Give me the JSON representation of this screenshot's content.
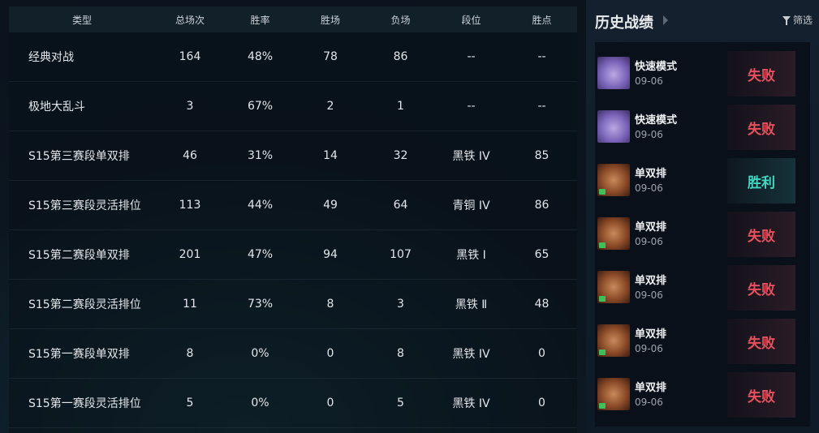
{
  "table": {
    "headers": [
      "类型",
      "总场次",
      "胜率",
      "胜场",
      "负场",
      "段位",
      "胜点"
    ],
    "rows": [
      [
        "经典对战",
        "164",
        "48%",
        "78",
        "86",
        "--",
        "--"
      ],
      [
        "极地大乱斗",
        "3",
        "67%",
        "2",
        "1",
        "--",
        "--"
      ],
      [
        "S15第三赛段单双排",
        "46",
        "31%",
        "14",
        "32",
        "黑铁 IV",
        "85"
      ],
      [
        "S15第三赛段灵活排位",
        "113",
        "44%",
        "49",
        "64",
        "青铜 IV",
        "86"
      ],
      [
        "S15第二赛段单双排",
        "201",
        "47%",
        "94",
        "107",
        "黑铁 Ⅰ",
        "65"
      ],
      [
        "S15第二赛段灵活排位",
        "11",
        "73%",
        "8",
        "3",
        "黑铁 Ⅱ",
        "48"
      ],
      [
        "S15第一赛段单双排",
        "8",
        "0%",
        "0",
        "8",
        "黑铁 IV",
        "0"
      ],
      [
        "S15第一赛段灵活排位",
        "5",
        "0%",
        "0",
        "5",
        "黑铁 IV",
        "0"
      ]
    ]
  },
  "history": {
    "title": "历史战绩",
    "filter_label": "筛选",
    "matches": [
      {
        "mode": "快速模式",
        "date": "09-06",
        "result": "失败",
        "win": false,
        "avatar": "poro"
      },
      {
        "mode": "快速模式",
        "date": "09-06",
        "result": "失败",
        "win": false,
        "avatar": "poro"
      },
      {
        "mode": "单双排",
        "date": "09-06",
        "result": "胜利",
        "win": true,
        "avatar": "girl"
      },
      {
        "mode": "单双排",
        "date": "09-06",
        "result": "失败",
        "win": false,
        "avatar": "girl"
      },
      {
        "mode": "单双排",
        "date": "09-06",
        "result": "失败",
        "win": false,
        "avatar": "girl"
      },
      {
        "mode": "单双排",
        "date": "09-06",
        "result": "失败",
        "win": false,
        "avatar": "girl"
      },
      {
        "mode": "单双排",
        "date": "09-06",
        "result": "失败",
        "win": false,
        "avatar": "girl"
      }
    ]
  },
  "colors": {
    "loss": "#e8505e",
    "win": "#43d6c0"
  }
}
